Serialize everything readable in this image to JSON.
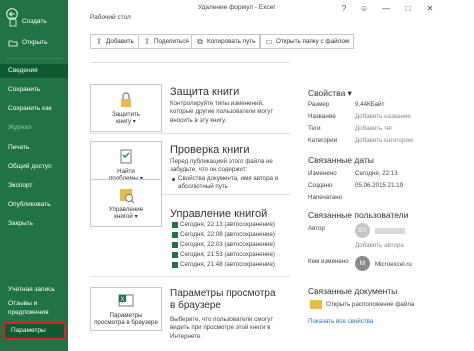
{
  "window": {
    "title": "Удаление формул - Excel",
    "help": "?",
    "minimize": "—",
    "maximize": "□",
    "close": "✕"
  },
  "sidebar": {
    "back_icon": "back-arrow-icon",
    "items": [
      {
        "label": "Создать",
        "icon": "new-icon"
      },
      {
        "label": "Открыть",
        "icon": "open-icon"
      },
      {
        "label": "Сведения"
      },
      {
        "label": "Сохранить"
      },
      {
        "label": "Сохранить как"
      },
      {
        "label": "Журнал"
      },
      {
        "label": "Печать"
      },
      {
        "label": "Общий доступ"
      },
      {
        "label": "Экспорт"
      },
      {
        "label": "Опубликовать"
      },
      {
        "label": "Закрыть"
      },
      {
        "label": "Учетная запись"
      },
      {
        "label": "Отзывы и"
      },
      {
        "label": "предложения"
      },
      {
        "label": "Параметры"
      }
    ]
  },
  "location": {
    "path": "Рабочий стол",
    "buttons": [
      {
        "label": "Добавить",
        "icon": "upload-icon"
      },
      {
        "label": "Поделиться",
        "icon": "share-icon"
      },
      {
        "label": "Копировать путь",
        "icon": "copy-icon"
      },
      {
        "label": "Открыть папку с файлом",
        "icon": "folder-icon"
      }
    ]
  },
  "sections": {
    "protect": {
      "button": [
        "Защитить",
        "книгу ▾"
      ],
      "title": "Защита книги",
      "desc": "Контролируйте типы изменений, которые другие пользователи могут вносить в эту книгу."
    },
    "inspect": {
      "button": [
        "Найти",
        "проблемы ▾"
      ],
      "title": "Проверка книги",
      "desc_intro": "Перед публикацией этого файла не забудьте, что он содержит:",
      "bullets": [
        "Свойства документа, имя автора и абсолютный путь"
      ]
    },
    "manage": {
      "button": [
        "Управление",
        "книгой ▾"
      ],
      "title": "Управление книгой",
      "versions": [
        "Сегодня, 22:13 (автосохранение)",
        "Сегодня, 22:08 (автосохранение)",
        "Сегодня, 22:03 (автосохранение)",
        "Сегодня, 21:53 (автосохранение)",
        "Сегодня, 21:48 (автосохранение)"
      ]
    },
    "browser": {
      "button": [
        "Параметры",
        "просмотра в браузере"
      ],
      "title": "Параметры просмотра",
      "title2": "в браузере",
      "desc": "Выберите, что пользователи смогут видеть при просмотре этой книги в Интернете."
    }
  },
  "properties": {
    "heading": "Свойства ▾",
    "rows": [
      {
        "label": "Размер",
        "value": "9,44КБайт",
        "muted": false
      },
      {
        "label": "Название",
        "value": "Добавить название",
        "muted": true
      },
      {
        "label": "Теги",
        "value": "Добавить тег",
        "muted": true
      },
      {
        "label": "Категории",
        "value": "Добавить категорию",
        "muted": true
      }
    ]
  },
  "dates": {
    "heading": "Связанные даты",
    "rows": [
      {
        "label": "Изменено",
        "value": "Сегодня, 22:13"
      },
      {
        "label": "Создано",
        "value": "05.06.2015 21:19"
      },
      {
        "label": "Напечатано",
        "value": ""
      }
    ]
  },
  "people": {
    "heading": "Связанные пользователи",
    "author_label": "Автор",
    "author_initials": "SY",
    "add_author": "Добавить автора",
    "changed_by_label": "Кем изменено",
    "changed_by_initial": "M",
    "changed_by_name": "Microexcel.ru",
    "avatar_color_1": "#c5c5c5",
    "avatar_color_2": "#8a8a8a"
  },
  "documents": {
    "heading": "Связанные документы",
    "open_location": "Открыть расположение файла",
    "show_all": "Показать все свойства"
  },
  "colors": {
    "accent": "#217346",
    "active": "#0f5a30",
    "highlight": "#e02020"
  }
}
